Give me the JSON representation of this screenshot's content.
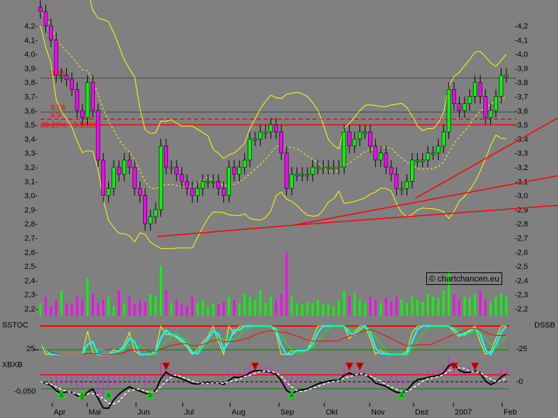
{
  "chart_data": {
    "type": "candlestick",
    "ylim": [
      2.2,
      4.2
    ],
    "yticks": [
      "4,2",
      "4,1",
      "4,0",
      "3,9",
      "3,8",
      "3,7",
      "3,6",
      "3,5",
      "3,4",
      "3,3",
      "3,2",
      "3,1",
      "3,0",
      "2,9",
      "2,8",
      "2,7",
      "2,6",
      "2,5",
      "2,4",
      "2,3",
      "2,2"
    ],
    "months": [
      "Apr",
      "Mai",
      "Jun",
      "Jul",
      "Aug",
      "Sep",
      "Okt",
      "Nov",
      "Dez",
      "2007",
      "Feb"
    ],
    "close": [
      4.3,
      4.2,
      4.1,
      3.85,
      3.85,
      3.82,
      3.75,
      3.6,
      3.55,
      3.8,
      3.6,
      3.25,
      3.0,
      3.05,
      3.2,
      3.15,
      3.25,
      3.2,
      3.05,
      3.0,
      2.8,
      2.85,
      2.9,
      3.35,
      3.2,
      3.2,
      3.15,
      3.1,
      3.05,
      3.0,
      3.05,
      3.1,
      3.1,
      3.1,
      3.05,
      3.0,
      3.2,
      3.15,
      3.2,
      3.25,
      3.4,
      3.4,
      3.45,
      3.45,
      3.5,
      3.45,
      3.3,
      3.05,
      3.15,
      3.15,
      3.15,
      3.15,
      3.2,
      3.2,
      3.2,
      3.2,
      3.2,
      3.2,
      3.45,
      3.35,
      3.4,
      3.45,
      3.45,
      3.35,
      3.25,
      3.3,
      3.2,
      3.15,
      3.05,
      3.05,
      3.1,
      3.25,
      3.25,
      3.25,
      3.3,
      3.3,
      3.35,
      3.45,
      3.75,
      3.65,
      3.6,
      3.65,
      3.7,
      3.8,
      3.7,
      3.55,
      3.6,
      3.7,
      3.85,
      3.85
    ],
    "volume": [
      20,
      30,
      15,
      25,
      40,
      20,
      18,
      30,
      25,
      60,
      35,
      20,
      25,
      30,
      15,
      40,
      20,
      30,
      18,
      25,
      22,
      35,
      30,
      80,
      40,
      20,
      25,
      18,
      15,
      30,
      20,
      25,
      15,
      20,
      18,
      22,
      30,
      25,
      20,
      35,
      30,
      25,
      40,
      20,
      30,
      25,
      35,
      100,
      30,
      20,
      18,
      22,
      20,
      25,
      18,
      20,
      15,
      25,
      40,
      30,
      35,
      25,
      20,
      30,
      25,
      20,
      28,
      22,
      30,
      25,
      20,
      30,
      25,
      22,
      35,
      30,
      28,
      40,
      70,
      35,
      25,
      30,
      28,
      35,
      40,
      25,
      22,
      30,
      35,
      30
    ],
    "levels": [
      {
        "value": 3.83,
        "label": "3.83",
        "style": "solid"
      },
      {
        "value": 3.59,
        "label": "3.59",
        "style": "solid"
      },
      {
        "value": 3.54,
        "label": "3.5",
        "style": "dashed"
      },
      {
        "value": 3.5,
        "label": "38.20% - 3.5320",
        "style": "solid"
      }
    ],
    "trendlines": [
      {
        "from": [
          22.3,
          2.71
        ],
        "to": [
          48.3,
          2.79
        ]
      },
      {
        "from": [
          48.3,
          2.79
        ],
        "to": [
          98.9,
          3.14
        ]
      },
      {
        "from": [
          48.3,
          2.79
        ],
        "to": [
          98.9,
          2.93
        ]
      },
      {
        "from": [
          71.6,
          2.98
        ],
        "to": [
          98.9,
          3.55
        ]
      }
    ],
    "colors": {
      "up": "#00ff00",
      "down": "#ff00ff",
      "band": "#ffff00",
      "level": "#ff0000",
      "background": "#808080"
    },
    "panels": {
      "stoch": {
        "label_left": "SSTOC",
        "label_right": "DSSB",
        "tick": "25",
        "tick_right": "-25"
      },
      "xbxb": {
        "label_left": "XBXB",
        "tick": "-0,050",
        "tick_right": "-0"
      }
    }
  },
  "credit": "© chartchancen.eu"
}
